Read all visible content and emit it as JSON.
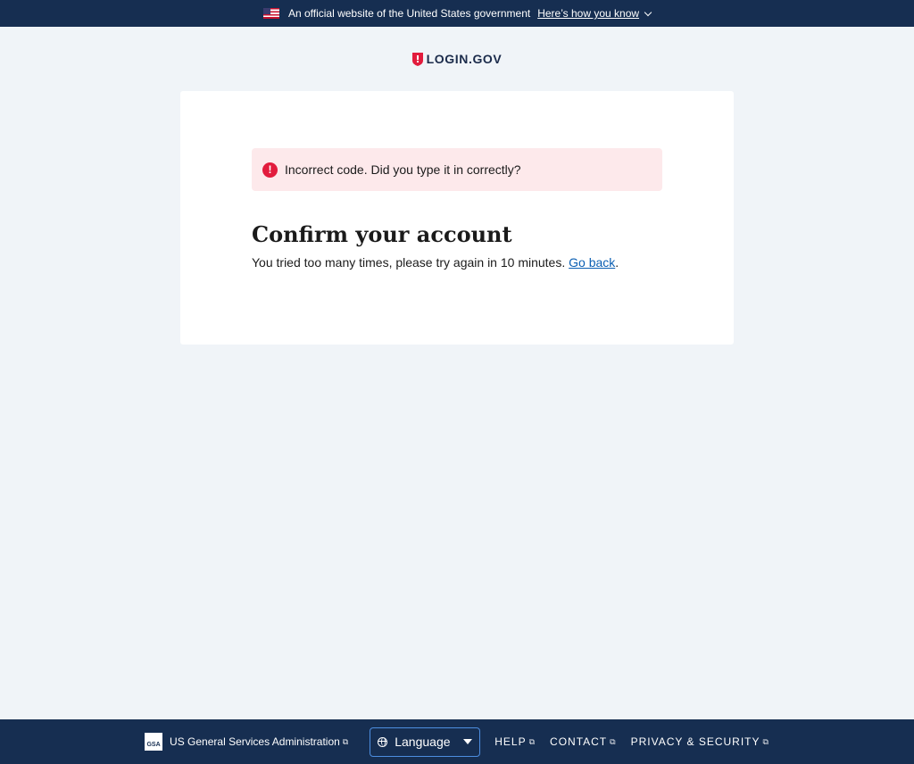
{
  "banner": {
    "text": "An official website of the United States government",
    "link": "Here’s how you know"
  },
  "logo": {
    "text": "LOGIN.GOV"
  },
  "alert": {
    "icon": "!",
    "text": "Incorrect code. Did you type it in correctly?"
  },
  "page": {
    "title": "Confirm your account",
    "message": "You tried too many times, please try again in 10 minutes.",
    "link": "Go back",
    "trailing": "."
  },
  "footer": {
    "gsa_logo": "GSA",
    "gsa_text": "US General Services Administration",
    "language_label": "Language",
    "help": "HELP",
    "contact": "CONTACT",
    "privacy": "PRIVACY & SECURITY",
    "external_icon": "⧉"
  },
  "colors": {
    "navy": "#162e51",
    "error_red": "#e21c3d",
    "alert_bg": "#fde9eb",
    "link_blue": "#0b5fb3",
    "logo_red": "#e21c3d"
  }
}
